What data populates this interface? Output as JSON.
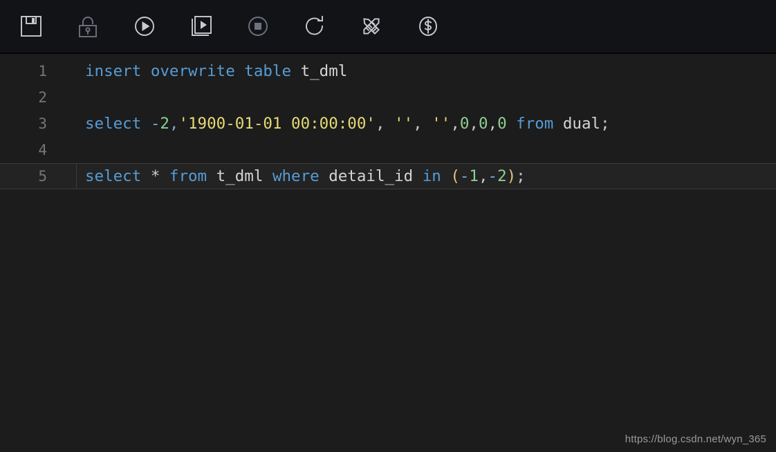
{
  "toolbar": {
    "buttons": [
      {
        "name": "save-button",
        "icon": "floppy-disk-icon",
        "label": "Save",
        "enabled": true
      },
      {
        "name": "lock-button",
        "icon": "padlock-icon",
        "label": "Lock",
        "enabled": false
      },
      {
        "name": "run-button",
        "icon": "play-circle-icon",
        "label": "Run",
        "enabled": true
      },
      {
        "name": "run-script-button",
        "icon": "play-square-icon",
        "label": "Run Script",
        "enabled": true
      },
      {
        "name": "stop-button",
        "icon": "stop-circle-icon",
        "label": "Stop",
        "enabled": false
      },
      {
        "name": "refresh-button",
        "icon": "refresh-icon",
        "label": "Refresh",
        "enabled": true
      },
      {
        "name": "format-button",
        "icon": "pencil-ruler-icon",
        "label": "Format",
        "enabled": true
      },
      {
        "name": "cost-button",
        "icon": "dollar-circle-icon",
        "label": "Cost Estimate",
        "enabled": true
      }
    ]
  },
  "editor": {
    "active_line": 5,
    "lines": [
      {
        "number": "1",
        "active": false,
        "tokens": [
          {
            "t": "insert",
            "c": "kw"
          },
          {
            "t": " ",
            "c": "punc"
          },
          {
            "t": "overwrite",
            "c": "kw"
          },
          {
            "t": " ",
            "c": "punc"
          },
          {
            "t": "table",
            "c": "kw"
          },
          {
            "t": " ",
            "c": "punc"
          },
          {
            "t": "t_dml",
            "c": "ident"
          }
        ]
      },
      {
        "number": "2",
        "active": false,
        "tokens": []
      },
      {
        "number": "3",
        "active": false,
        "tokens": [
          {
            "t": "select",
            "c": "kw"
          },
          {
            "t": " ",
            "c": "punc"
          },
          {
            "t": "-",
            "c": "op"
          },
          {
            "t": "2",
            "c": "num"
          },
          {
            "t": ",",
            "c": "op"
          },
          {
            "t": "'1900-01-01 00:00:00'",
            "c": "str"
          },
          {
            "t": ", ",
            "c": "punc"
          },
          {
            "t": "''",
            "c": "str"
          },
          {
            "t": ", ",
            "c": "punc"
          },
          {
            "t": "''",
            "c": "str"
          },
          {
            "t": ",",
            "c": "punc"
          },
          {
            "t": "0",
            "c": "num"
          },
          {
            "t": ",",
            "c": "punc"
          },
          {
            "t": "0",
            "c": "num"
          },
          {
            "t": ",",
            "c": "punc"
          },
          {
            "t": "0",
            "c": "num"
          },
          {
            "t": " ",
            "c": "punc"
          },
          {
            "t": "from",
            "c": "kw"
          },
          {
            "t": " ",
            "c": "punc"
          },
          {
            "t": "dual",
            "c": "ident"
          },
          {
            "t": ";",
            "c": "punc"
          }
        ]
      },
      {
        "number": "4",
        "active": false,
        "tokens": []
      },
      {
        "number": "5",
        "active": true,
        "tokens": [
          {
            "t": "select",
            "c": "kw"
          },
          {
            "t": " ",
            "c": "punc"
          },
          {
            "t": "*",
            "c": "punc"
          },
          {
            "t": " ",
            "c": "punc"
          },
          {
            "t": "from",
            "c": "kw"
          },
          {
            "t": " ",
            "c": "punc"
          },
          {
            "t": "t_dml",
            "c": "ident"
          },
          {
            "t": " ",
            "c": "punc"
          },
          {
            "t": "where",
            "c": "kw"
          },
          {
            "t": " ",
            "c": "punc"
          },
          {
            "t": "detail_id",
            "c": "ident"
          },
          {
            "t": " ",
            "c": "punc"
          },
          {
            "t": "in",
            "c": "kw"
          },
          {
            "t": " ",
            "c": "punc"
          },
          {
            "t": "(",
            "c": "paren"
          },
          {
            "t": "-",
            "c": "op"
          },
          {
            "t": "1",
            "c": "num"
          },
          {
            "t": ",",
            "c": "punc"
          },
          {
            "t": "-",
            "c": "op"
          },
          {
            "t": "2",
            "c": "num"
          },
          {
            "t": ")",
            "c": "paren"
          },
          {
            "t": ";",
            "c": "punc"
          }
        ]
      }
    ]
  },
  "watermark": {
    "text": "https://blog.csdn.net/wyn_365"
  },
  "colors": {
    "toolbar_bg": "#121317",
    "editor_bg": "#1c1c1c",
    "active_line_bg": "#232323",
    "keyword": "#569cd6",
    "string": "#e6db74",
    "number": "#8fce92",
    "identifier": "#d4d4d4",
    "gutter": "#767676"
  }
}
